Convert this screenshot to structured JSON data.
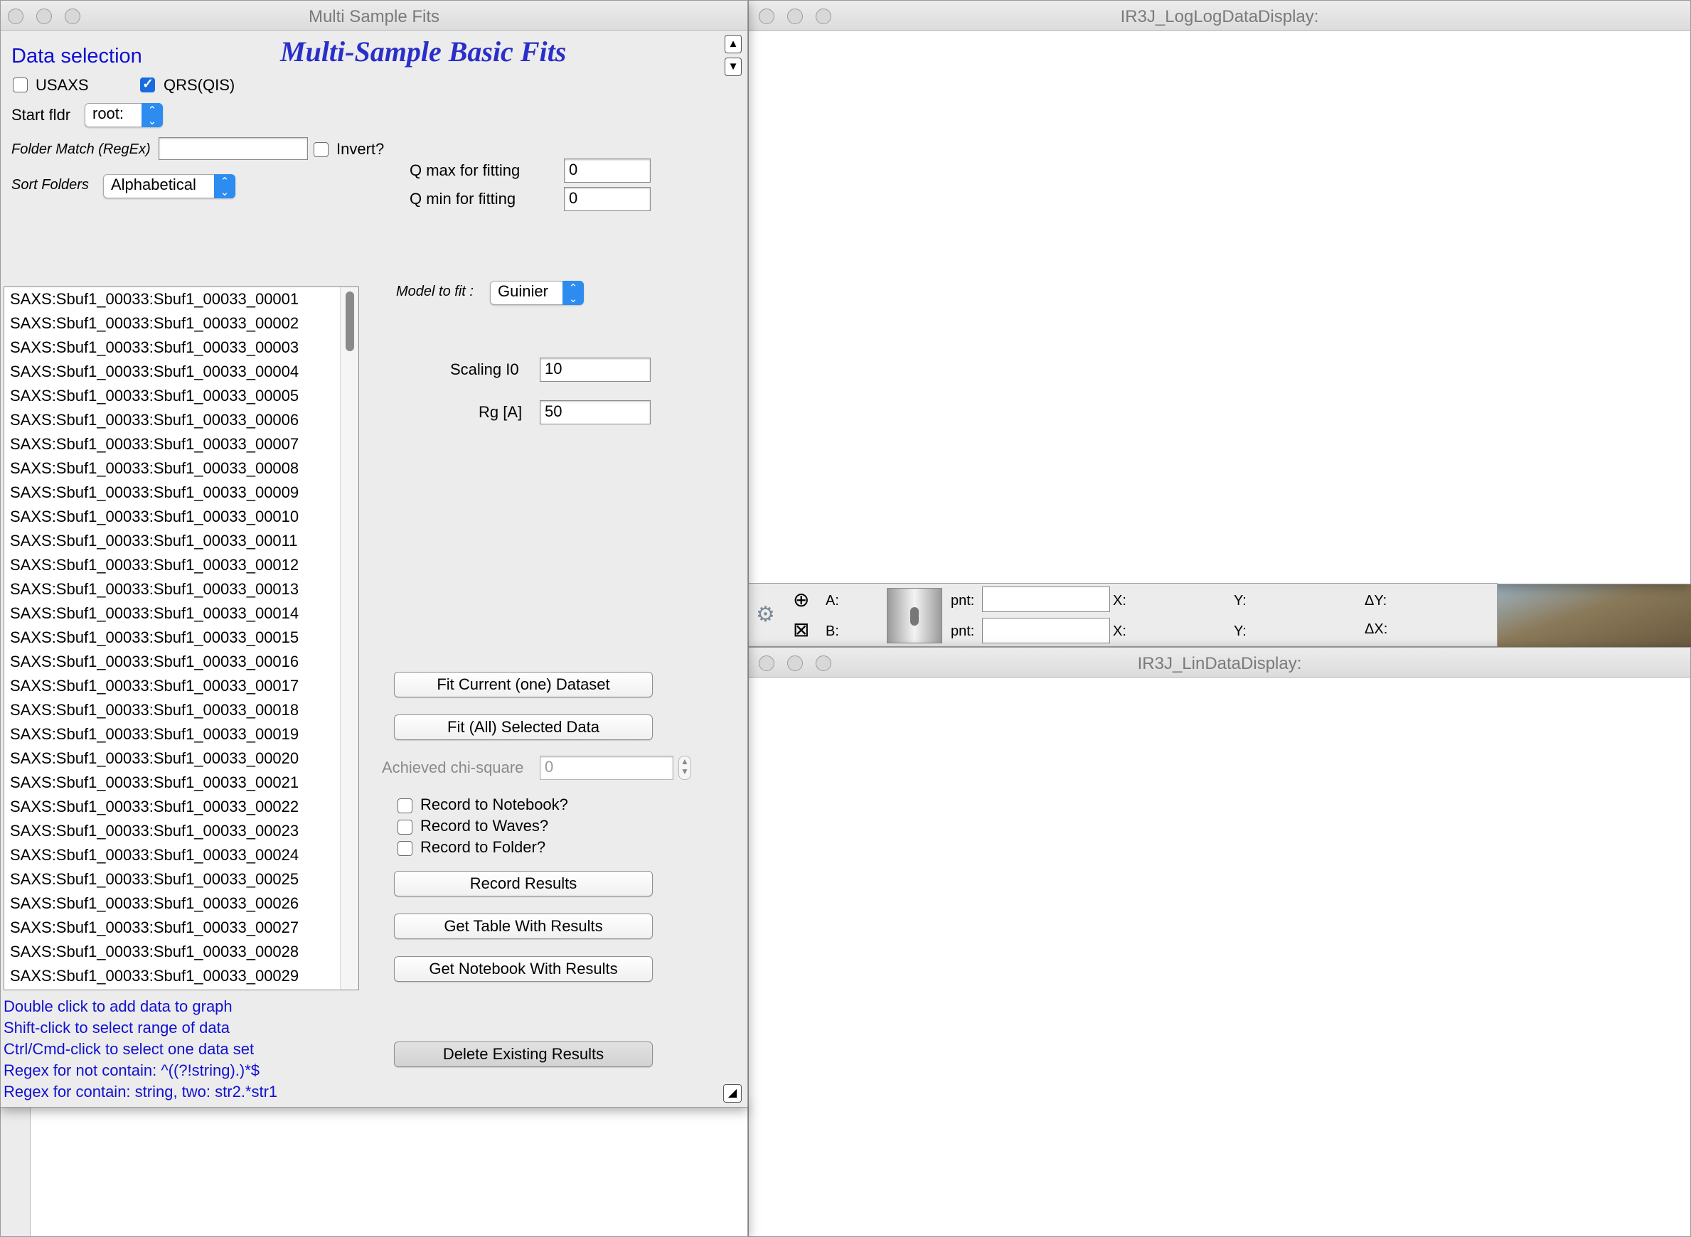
{
  "panel_window": {
    "title": "Multi Sample Fits",
    "heading": "Multi-Sample Basic Fits",
    "data_selection_label": "Data selection",
    "usaxs_label": "USAXS",
    "usaxs_checked": false,
    "qrs_label": "QRS(QIS)",
    "qrs_checked": true,
    "start_folder_label": "Start fldr",
    "start_folder_value": "root:",
    "folder_match_label": "Folder Match (RegEx)",
    "folder_match_value": "",
    "invert_label": "Invert?",
    "sort_folders_label": "Sort Folders",
    "sort_folders_value": "Alphabetical",
    "qmax_label": "Q max for fitting",
    "qmax_value": "0",
    "qmin_label": "Q min for fitting",
    "qmin_value": "0",
    "model_label": "Model to fit :",
    "model_value": "Guinier",
    "scaling_label": "Scaling I0",
    "scaling_value": "10",
    "rg_label": "Rg [A]",
    "rg_value": "50",
    "fit_current_button": "Fit Current (one) Dataset",
    "fit_all_button": "Fit (All) Selected Data",
    "chi_square_label": "Achieved chi-square",
    "chi_square_value": "0",
    "record_notebook_label": "Record to Notebook?",
    "record_waves_label": "Record to Waves?",
    "record_folder_label": "Record to Folder?",
    "record_results_button": "Record Results",
    "get_table_button": "Get Table With Results",
    "get_notebook_button": "Get Notebook With Results",
    "delete_results_button": "Delete Existing Results",
    "data_list": [
      "SAXS:Sbuf1_00033:Sbuf1_00033_00001",
      "SAXS:Sbuf1_00033:Sbuf1_00033_00002",
      "SAXS:Sbuf1_00033:Sbuf1_00033_00003",
      "SAXS:Sbuf1_00033:Sbuf1_00033_00004",
      "SAXS:Sbuf1_00033:Sbuf1_00033_00005",
      "SAXS:Sbuf1_00033:Sbuf1_00033_00006",
      "SAXS:Sbuf1_00033:Sbuf1_00033_00007",
      "SAXS:Sbuf1_00033:Sbuf1_00033_00008",
      "SAXS:Sbuf1_00033:Sbuf1_00033_00009",
      "SAXS:Sbuf1_00033:Sbuf1_00033_00010",
      "SAXS:Sbuf1_00033:Sbuf1_00033_00011",
      "SAXS:Sbuf1_00033:Sbuf1_00033_00012",
      "SAXS:Sbuf1_00033:Sbuf1_00033_00013",
      "SAXS:Sbuf1_00033:Sbuf1_00033_00014",
      "SAXS:Sbuf1_00033:Sbuf1_00033_00015",
      "SAXS:Sbuf1_00033:Sbuf1_00033_00016",
      "SAXS:Sbuf1_00033:Sbuf1_00033_00017",
      "SAXS:Sbuf1_00033:Sbuf1_00033_00018",
      "SAXS:Sbuf1_00033:Sbuf1_00033_00019",
      "SAXS:Sbuf1_00033:Sbuf1_00033_00020",
      "SAXS:Sbuf1_00033:Sbuf1_00033_00021",
      "SAXS:Sbuf1_00033:Sbuf1_00033_00022",
      "SAXS:Sbuf1_00033:Sbuf1_00033_00023",
      "SAXS:Sbuf1_00033:Sbuf1_00033_00024",
      "SAXS:Sbuf1_00033:Sbuf1_00033_00025",
      "SAXS:Sbuf1_00033:Sbuf1_00033_00026",
      "SAXS:Sbuf1_00033:Sbuf1_00033_00027",
      "SAXS:Sbuf1_00033:Sbuf1_00033_00028",
      "SAXS:Sbuf1_00033:Sbuf1_00033_00029"
    ],
    "hints": [
      "Double click to add data to graph",
      "Shift-click to select range of data",
      "Ctrl/Cmd-click to select one data set",
      "Regex for not contain: ^((?!string).)*$",
      "Regex for contain:  string, two: str2.*str1"
    ]
  },
  "loglog_window": {
    "title": "IR3J_LogLogDataDisplay:"
  },
  "lin_window": {
    "title": "IR3J_LinDataDisplay:"
  },
  "cursor_bar": {
    "a_label": "A:",
    "b_label": "B:",
    "pnt_label": "pnt:",
    "x_label": "X:",
    "y_label": "Y:",
    "dy_label": "ΔY:",
    "dx_label": "ΔX:"
  }
}
